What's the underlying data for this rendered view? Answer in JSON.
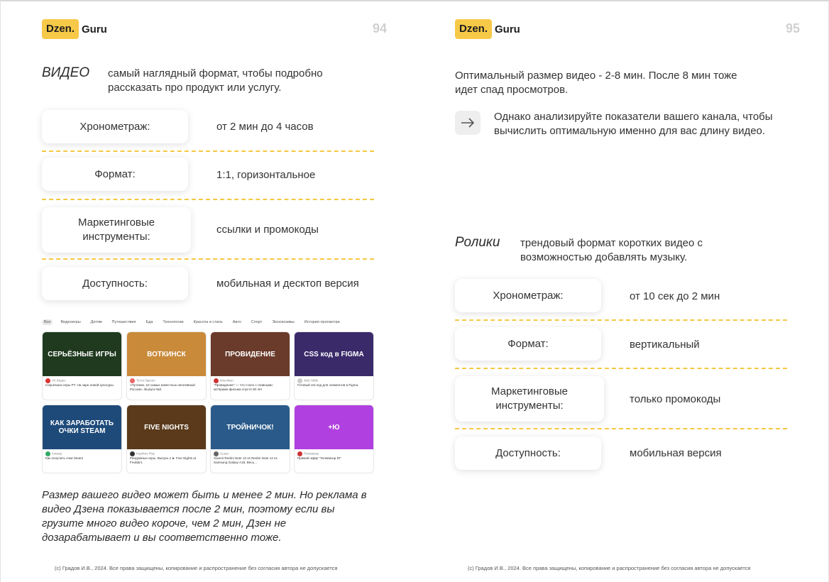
{
  "logo": {
    "badge": "Dzen.",
    "name": "Guru"
  },
  "left": {
    "page_number": "94",
    "heading": "ВИДЕО",
    "lead": "самый наглядный формат, чтобы подробно рассказать про продукт или услугу.",
    "rows": [
      {
        "label": "Хронометраж:",
        "value": "от 2 мин до 4 часов"
      },
      {
        "label": "Формат:",
        "value": "1:1, горизонтальное"
      },
      {
        "label": "Маркетинговые инструменты:",
        "value": "ссылки и промокоды"
      },
      {
        "label": "Доступность:",
        "value": "мобильная и десктоп версия"
      }
    ],
    "filters": [
      "Все",
      "Видеоигры",
      "Детям",
      "Путешествия",
      "Еда",
      "Технологии",
      "Красота и стиль",
      "Авто",
      "Спорт",
      "Эксклюзивы",
      "История просмотра"
    ],
    "tiles": [
      {
        "img": "СЕРЬЁЗНЫЕ ИГРЫ",
        "chan": "VK Видео",
        "title": "Серьёзные игры PT. На заре новой культуры",
        "bg": "#1f3a1f",
        "ava": "#d33"
      },
      {
        "img": "ВОТКИНСК",
        "chan": "Тутта Ларсен",
        "title": "«Путинки. 10 самых известных негативный России». Выпуск №2",
        "bg": "#c98a3a",
        "ava": "#e66"
      },
      {
        "img": "ПРОВИДЕНИЕ",
        "chan": "КиноФакт",
        "title": "\"Провидение\" — что стало с главными актёрами фильма спустя 30 лет",
        "bg": "#6a3a2a",
        "ava": "#c33"
      },
      {
        "img": "CSS код в FIGMA",
        "chan": "Web Skills",
        "title": "Готовый css код для элементов в Figma.",
        "bg": "#3a2a6a",
        "ava": "#ccc"
      },
      {
        "img": "КАК ЗАРАБОТАТЬ ОЧКИ STEAM",
        "chan": "Клевер",
        "title": "Как получить очки Steam",
        "bg": "#1e4a7a",
        "ava": "#3a6"
      },
      {
        "img": "FIVE NIGHTS",
        "chan": "Kuplinov Play",
        "title": "Рандомные игры. Выпуск 4 ► Five Nights at Freddy's",
        "bg": "#5a3a1a",
        "ava": "#333"
      },
      {
        "img": "ТРОЙНИЧОК!",
        "chan": "Gusev",
        "title": "Xiaomi Redmi Note 13 vs Redmi Note 12 vs Samsung Galaxy A15. Весь...",
        "bg": "#2a5a8a",
        "ava": "#666"
      },
      {
        "img": "+Ю",
        "chan": "Телевизор",
        "title": "Прямой эфир \"Телевизор Ю\"",
        "bg": "#b040e0",
        "ava": "#c33"
      }
    ],
    "bottom_text": "Размер вашего видео может быть и менее 2 мин. Но реклама в видео Дзена показывается после 2 мин, поэтому если вы грузите много видео короче, чем 2 мин, Дзен не дозарабатывает и вы соответственно тоже.",
    "footer": "(с) Градов И.В., 2024. Все права защищены, копирование и распространение без согласия автора не допускается"
  },
  "right": {
    "page_number": "95",
    "lead": "Оптимальный размер видео - 2-8 мин. После 8 мин тоже идет спад просмотров.",
    "tip": "Однако анализируйте показатели вашего канала, чтобы вычислить оптимальную именно для вас длину видео.",
    "heading": "Ролики",
    "heading_lead": "трендовый формат коротких видео с возможностью добавлять музыку.",
    "rows": [
      {
        "label": "Хронометраж:",
        "value": "от 10 сек до 2 мин"
      },
      {
        "label": "Формат:",
        "value": "вертикальный"
      },
      {
        "label": "Маркетинговые инструменты:",
        "value": "только промокоды"
      },
      {
        "label": "Доступность:",
        "value": "мобильная версия"
      }
    ],
    "footer": "(с) Градов И.В., 2024. Все права защищены, копирование и распространение без согласия автора не допускается"
  }
}
